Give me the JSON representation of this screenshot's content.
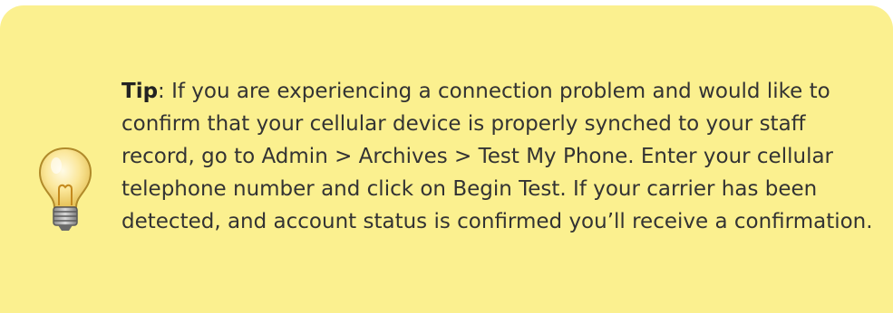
{
  "tip": {
    "icon": "lightbulb-icon",
    "label": "Tip",
    "separator": ":",
    "body": " If you are experiencing a connection problem and would like to confirm that your cellular device is properly synched to your staff record, go to Admin > Archives > Test My Phone. Enter your cellular telephone number and click on Begin Test. If your carrier has been detected, and account status is confirmed you’ll receive a confirmation."
  },
  "colors": {
    "background": "#fbf08f",
    "text": "#333333"
  }
}
